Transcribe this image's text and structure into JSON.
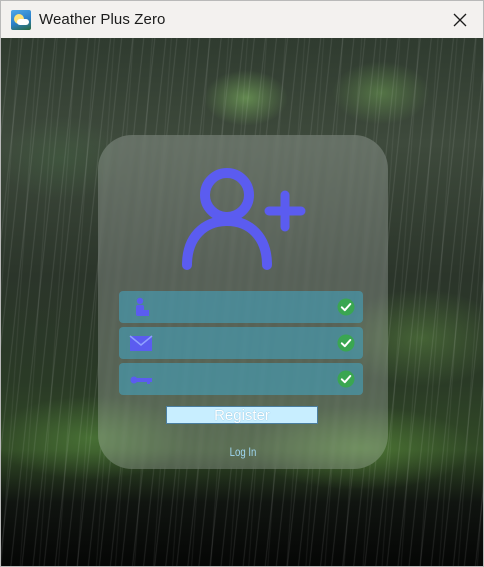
{
  "window": {
    "title": "Weather Plus Zero",
    "app_icon": "weather-app-icon",
    "close_icon": "close-icon"
  },
  "register_form": {
    "header_icon": "user-add-icon",
    "fields": [
      {
        "icon": "user-icon",
        "value": "",
        "status_icon": "check-icon"
      },
      {
        "icon": "mail-icon",
        "value": "",
        "status_icon": "check-icon"
      },
      {
        "icon": "key-icon",
        "value": "",
        "status_icon": "check-icon"
      }
    ],
    "register_label": "Register",
    "login_label": "Log In"
  },
  "colors": {
    "accent_icon": "#5b5cf0",
    "field_bg": "#46a0b9",
    "check_green": "#3aa651",
    "button_bg": "#c8eeff",
    "link": "#9fd7f2"
  }
}
